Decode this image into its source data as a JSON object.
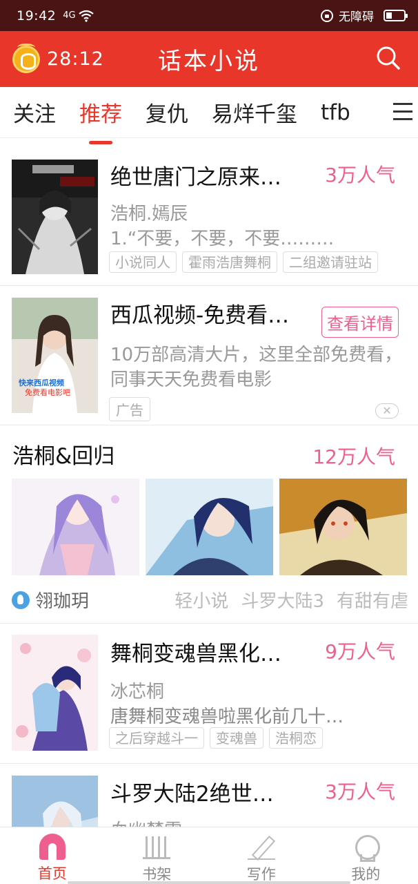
{
  "status": {
    "time": "19:42",
    "signal": "4G",
    "accessibility": "无障碍"
  },
  "header": {
    "timer": "28:12",
    "title": "话本小说"
  },
  "tabs": [
    "关注",
    "推荐",
    "复仇",
    "易烊千玺",
    "tfb"
  ],
  "feed": {
    "book1": {
      "title": "绝世唐门之原来…",
      "popularity": "3万人气",
      "author": "浩桐.嫣辰",
      "desc": "1.“不要，不要，不要………",
      "tags": [
        "小说同人",
        "霍雨浩唐舞桐",
        "二组邀请驻站"
      ]
    },
    "ad": {
      "title": "西瓜视频-免费看…",
      "button": "查看详情",
      "desc": "10万部高清大片，这里全部免费看，同事天天免费看电影",
      "tag": "广告",
      "cover_text_1": "快来西瓜视频",
      "cover_text_2": "免费看电影吧"
    },
    "topic": {
      "title": "浩桐&回归",
      "popularity": "12万人气",
      "user": "翎珈玥",
      "tags": [
        "轻小说",
        "斗罗大陆3",
        "有甜有虐"
      ]
    },
    "book3": {
      "title": "舞桐变魂兽黑化…",
      "popularity": "9万人气",
      "author": "冰芯桐",
      "desc": "唐舞桐变魂兽啦黑化前几十…",
      "tags": [
        "之后穿越斗一",
        "变魂兽",
        "浩桐恋"
      ]
    },
    "book4": {
      "title": "斗罗大陆2绝世…",
      "popularity": "3万人气",
      "author": "血幽梦雪"
    }
  },
  "nav": [
    "首页",
    "书架",
    "写作",
    "我的"
  ],
  "colors": {
    "brand_red": "#e8372a",
    "status_bar": "#4a1414",
    "accent_pink": "#ee5f8f"
  }
}
